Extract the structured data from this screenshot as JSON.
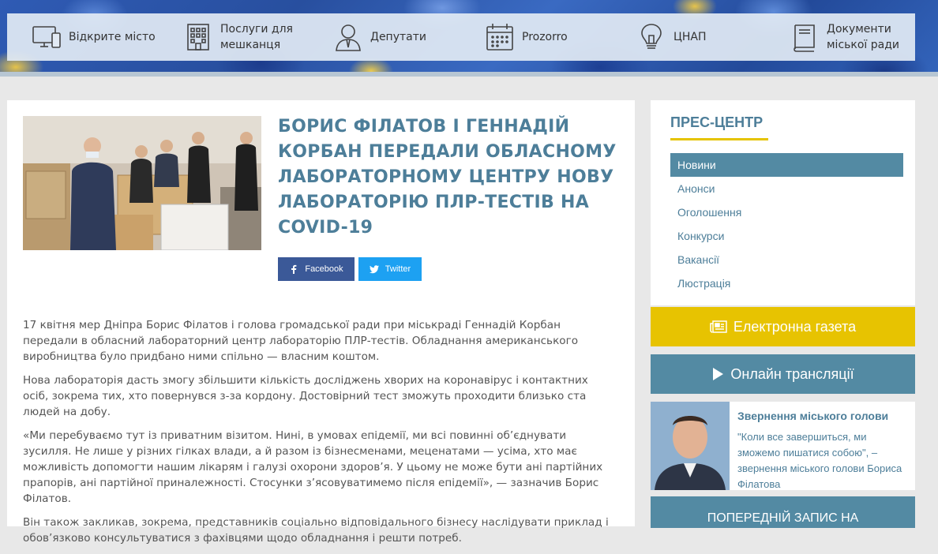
{
  "topnav": [
    {
      "label": "Відкрите місто",
      "icon": "devices-icon"
    },
    {
      "label": "Послуги для мешканця",
      "icon": "building-icon"
    },
    {
      "label": "Депутати",
      "icon": "deputy-icon"
    },
    {
      "label": "Prozorro",
      "icon": "calendar-icon"
    },
    {
      "label": "ЦНАП",
      "icon": "lightbulb-icon"
    },
    {
      "label": "Документи міської ради",
      "icon": "book-icon"
    }
  ],
  "article": {
    "title": "Борис Філатов і Геннадій Корбан передали обласному лабораторному центру нову лабораторію ПЛР-тестів на COVID-19",
    "share": {
      "facebook": "Facebook",
      "twitter": "Twitter"
    },
    "paragraphs": [
      "17 квітня мер Дніпра Борис Філатов і голова громадської ради при міськраді Геннадій Корбан передали в обласний лабораторний центр лабораторію ПЛР-тестів. Обладнання американського виробництва було придбано ними спільно — власним коштом.",
      "Нова лабораторія дасть змогу збільшити кількість досліджень хворих на коронавірус і контактних осіб, зокрема тих, хто повернувся з-за кордону. Достовірний тест зможуть проходити близько ста людей на добу.",
      "«Ми перебуваємо тут із приватним візитом. Нині, в умовах епідемії, ми всі повинні об’єднувати зусилля. Не лише у різних гілках влади, а й разом із бізнесменами, меценатами — усіма, хто має можливість допомогти нашим лікарям і галузі охорони здоров’я. У цьому не може бути ані партійних прапорів, ані партійної приналежності. Стосунки з’ясовуватимемо після епідемії», — зазначив Борис Філатов.",
      "Він також закликав, зокрема, представників соціально відповідального бізнесу наслідувати приклад і обов’язково консультуватися з фахівцями щодо обладнання і решти потреб."
    ]
  },
  "sidebar": {
    "press_title": "ПРЕС-ЦЕНТР",
    "menu": [
      "Новини",
      "Анонси",
      "Оголошення",
      "Конкурси",
      "Вакансії",
      "Люстрація"
    ],
    "newspaper_label": "Електронна газета",
    "stream_label": "Онлайн трансляції",
    "mayor": {
      "title": "Звернення міського голови",
      "text": "\"Коли все завершиться, ми зможемо пишатися собою\", – звернення міського голови Бориса Філатова"
    },
    "prereg_label": "ПОПЕРЕДНІЙ ЗАПИС НА"
  },
  "colors": {
    "accent": "#4d7e99",
    "active_menu": "#538aa3",
    "newspaper": "#e7c301",
    "facebook": "#3b5998",
    "twitter": "#1da1f2"
  }
}
